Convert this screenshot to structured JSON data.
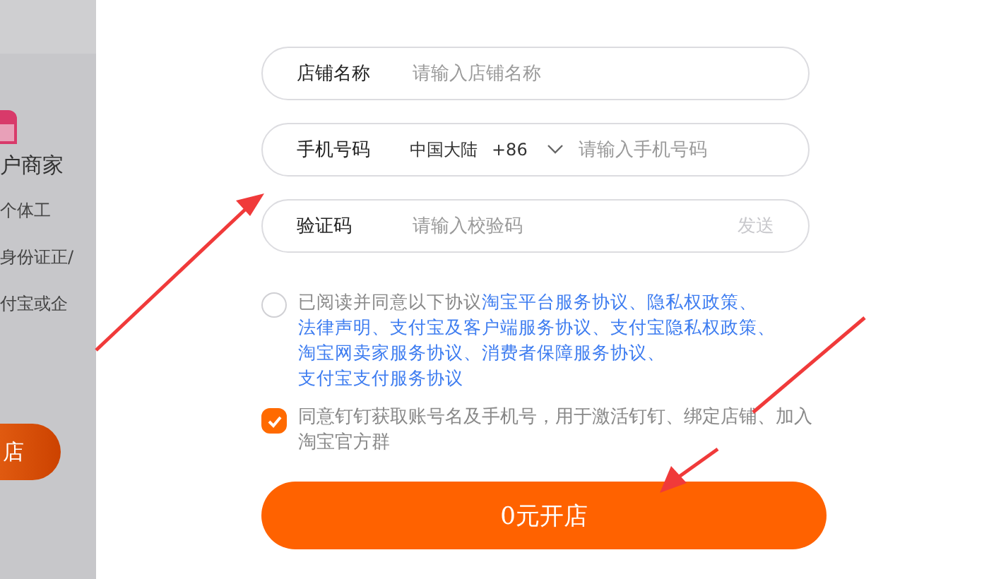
{
  "side_card": {
    "title": "户商家",
    "lines": [
      "个体工",
      "身份证正/",
      "付宝或企"
    ],
    "button": "店"
  },
  "fields": [
    {
      "kind": "text",
      "label": "店铺名称",
      "placeholder": "请输入店铺名称"
    },
    {
      "kind": "phone",
      "label": "手机号码",
      "region": "中国大陆",
      "code": "+86",
      "placeholder": "请输入手机号码"
    },
    {
      "kind": "code",
      "label": "验证码",
      "placeholder": "请输入校验码",
      "action": "发送"
    }
  ],
  "agreements": [
    {
      "checked": false,
      "text": "已阅读并同意以下协议",
      "links": [
        "淘宝平台服务协议",
        "隐私权政策",
        "法律声明",
        "支付宝及客户端服务协议",
        "支付宝隐私权政策",
        "淘宝网卖家服务协议",
        "消费者保障服务协议",
        "支付宝支付服务协议"
      ],
      "separator": "、"
    },
    {
      "checked": true,
      "text": "同意钉钉获取账号名及手机号，用于激活钉钉、绑定店铺、加入淘宝官方群"
    }
  ],
  "submit": "0元开店"
}
